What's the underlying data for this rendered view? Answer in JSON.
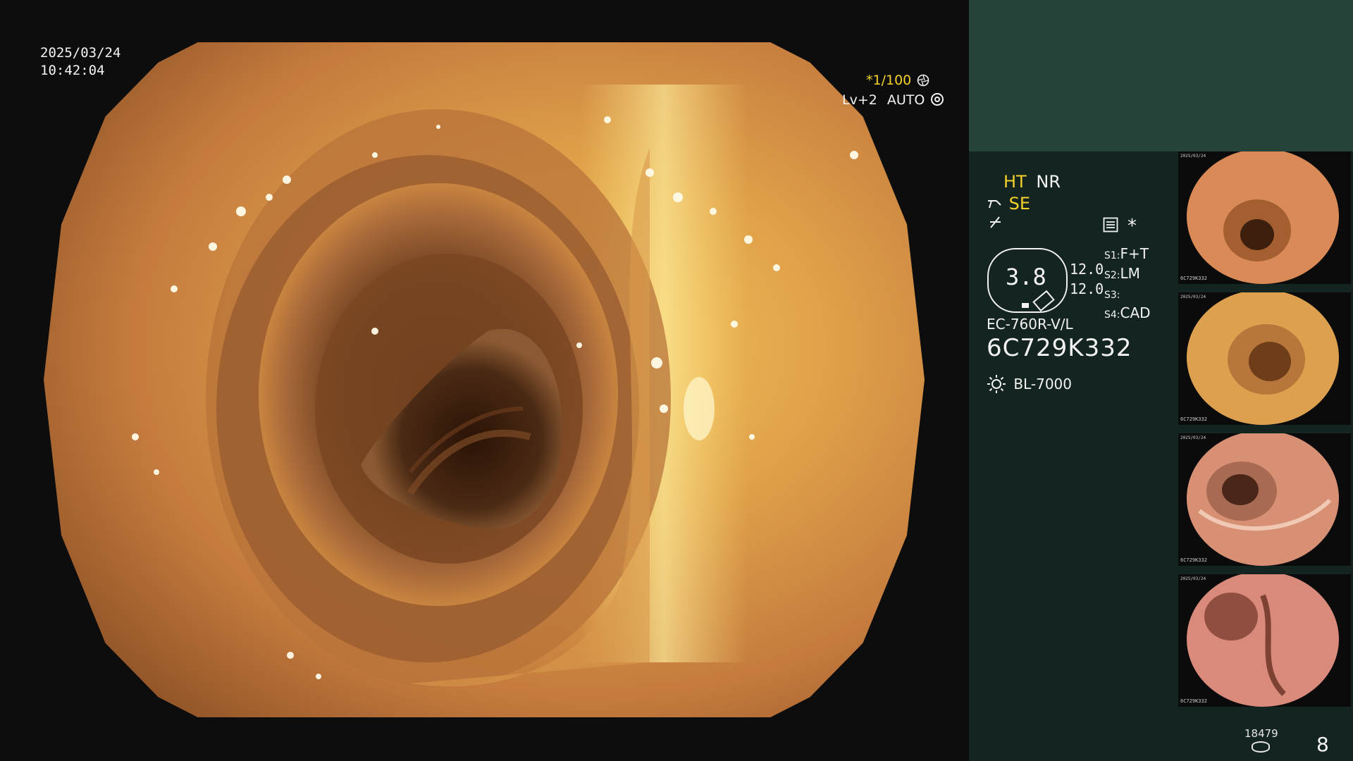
{
  "overlay": {
    "date": "2025/03/24",
    "time": "10:42:04",
    "shutter": "*1/100",
    "level": "Lv+2",
    "iris": "AUTO"
  },
  "modes": {
    "ht": "HT",
    "nr": "NR",
    "se": "SE",
    "star": "*"
  },
  "zoom": {
    "value": "3.8",
    "param_a": "12.0",
    "param_b": "12.0"
  },
  "switches": {
    "s1_label": "S1:",
    "s1_value": "F+T",
    "s2_label": "S2:",
    "s2_value": "LM",
    "s3_label": "S3:",
    "s3_value": "",
    "s4_label": "S4:",
    "s4_value": "CAD"
  },
  "scope": {
    "model": "EC-760R-V/L",
    "serial": "6C729K332",
    "light_source": "BL-7000"
  },
  "thumbnails": [
    {
      "date": "2025/03/24",
      "serial": "6C729K332",
      "tone": "#d98a56"
    },
    {
      "date": "2025/03/24",
      "serial": "6C729K332",
      "tone": "#dca04f"
    },
    {
      "date": "2025/03/24",
      "serial": "6C729K332",
      "tone": "#d89075"
    },
    {
      "date": "2025/03/24",
      "serial": "6C729K332",
      "tone": "#d98a7a"
    }
  ],
  "counters": {
    "storage": "18479",
    "image_count": "8"
  },
  "icons": {
    "shutter": "aperture-icon",
    "iris": "ring-icon",
    "scope_tip": "scope-tip-icon",
    "light": "light-sun-icon",
    "storage": "disk-icon"
  }
}
